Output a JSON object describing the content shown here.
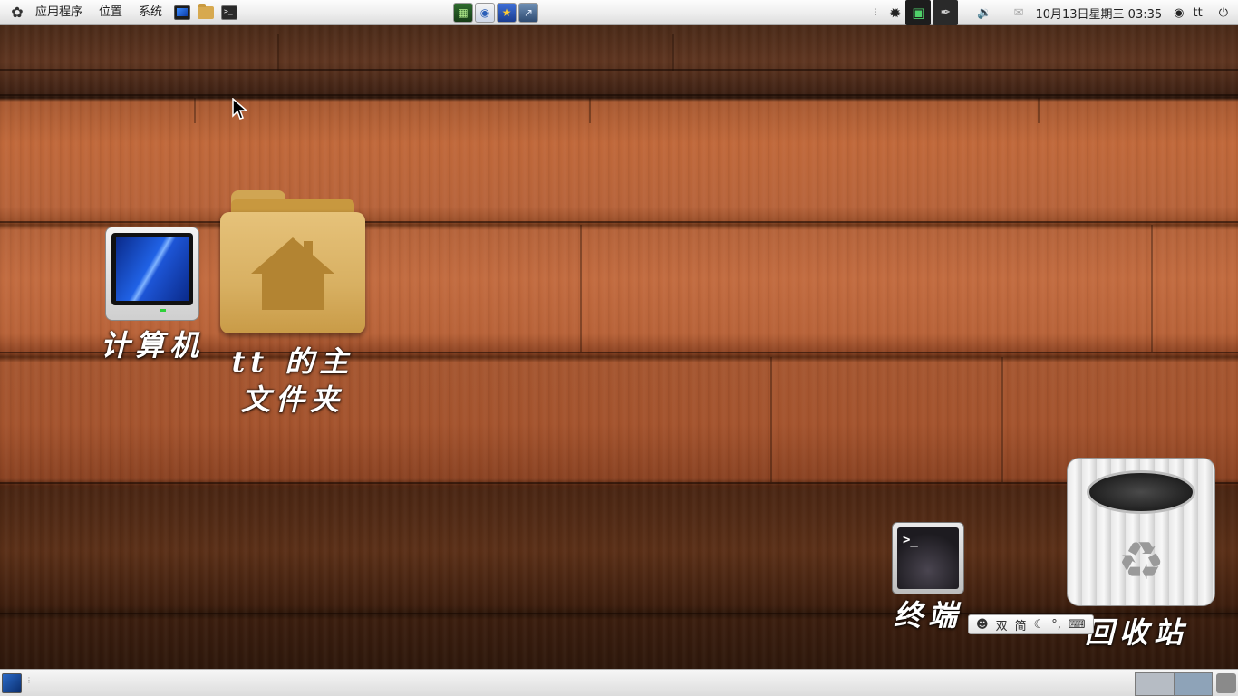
{
  "top_panel": {
    "menus": [
      "应用程序",
      "位置",
      "系统"
    ],
    "launchers": [
      "computer-icon",
      "home-folder-icon",
      "terminal-icon"
    ],
    "center_launchers": [
      "system-monitor-icon",
      "web-browser-icon",
      "favorites-icon",
      "chart-monitor-icon"
    ],
    "tray": {
      "clock": "10月13日星期三 03:35",
      "user": "tt"
    }
  },
  "desktop": {
    "icons": [
      {
        "label": "计算机",
        "icon": "computer-icon"
      },
      {
        "label_line1": "tt 的主",
        "label_line2": "文件夹",
        "icon": "home-folder-icon"
      },
      {
        "label": "终端",
        "icon": "terminal-icon"
      },
      {
        "label": "回收站",
        "icon": "trash-icon"
      }
    ]
  },
  "ime_bar": {
    "mode": "双",
    "charset": "简",
    "punct": "°,"
  },
  "terminal_prompt": ">_",
  "colors": {
    "panel_bg": "#eeeeee",
    "wood_light": "#c0683a",
    "wood_dark": "#3a1d0e",
    "label_text": "#ffffff"
  }
}
